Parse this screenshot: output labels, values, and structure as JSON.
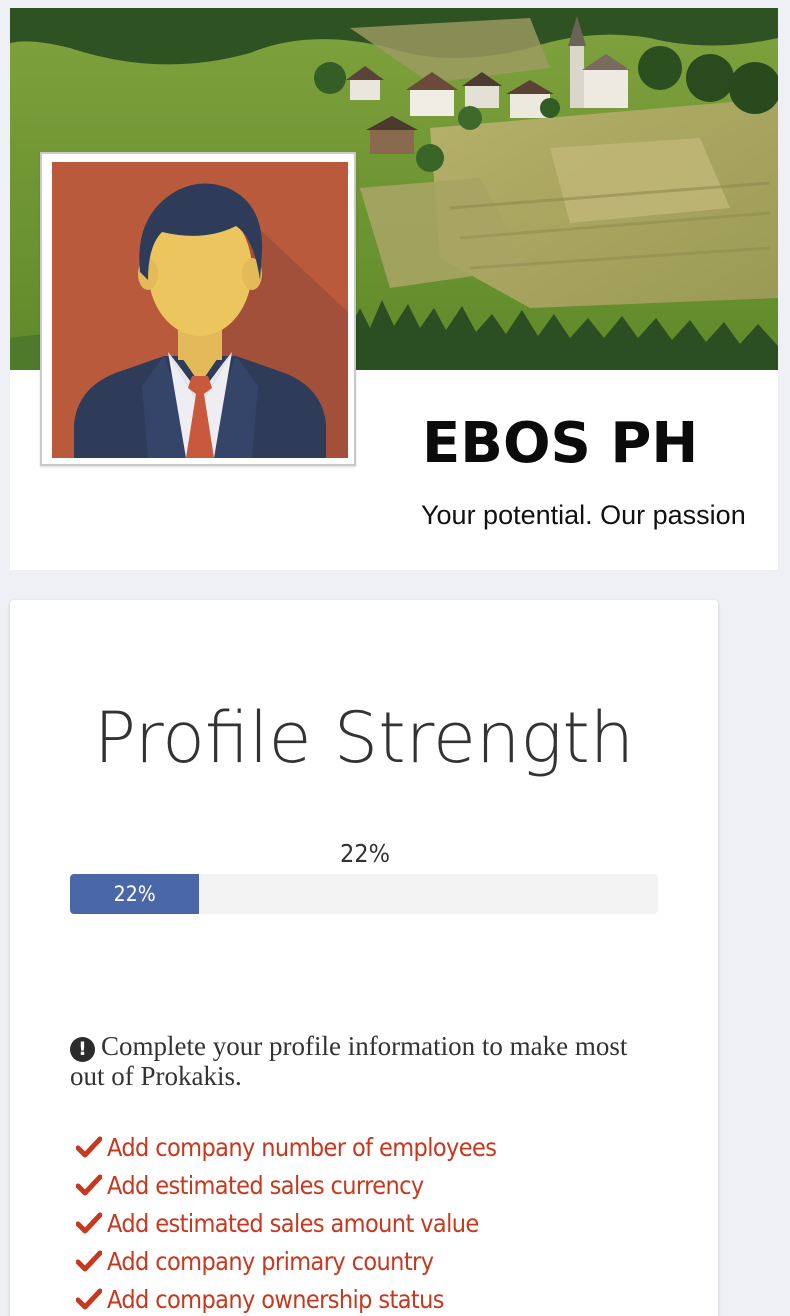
{
  "profile": {
    "company_name": "EBOS PH",
    "tagline": "Your potential. Our passion"
  },
  "strength": {
    "title": "Profile Strength",
    "percent": 22,
    "caption": "22%",
    "bar_label": "22%"
  },
  "notice": {
    "icon": "exclamation-circle-icon",
    "text": "Complete your profile information to make most out of Prokakis."
  },
  "todos": [
    {
      "icon": "check-icon",
      "label": "Add company number of employees"
    },
    {
      "icon": "check-icon",
      "label": "Add estimated sales currency"
    },
    {
      "icon": "check-icon",
      "label": "Add estimated sales amount value"
    },
    {
      "icon": "check-icon",
      "label": "Add company primary country"
    },
    {
      "icon": "check-icon",
      "label": "Add company ownership status"
    }
  ],
  "colors": {
    "progress_fill": "#4a67a8",
    "todo_text": "#c7381e",
    "avatar_background": "#b95a3d"
  }
}
